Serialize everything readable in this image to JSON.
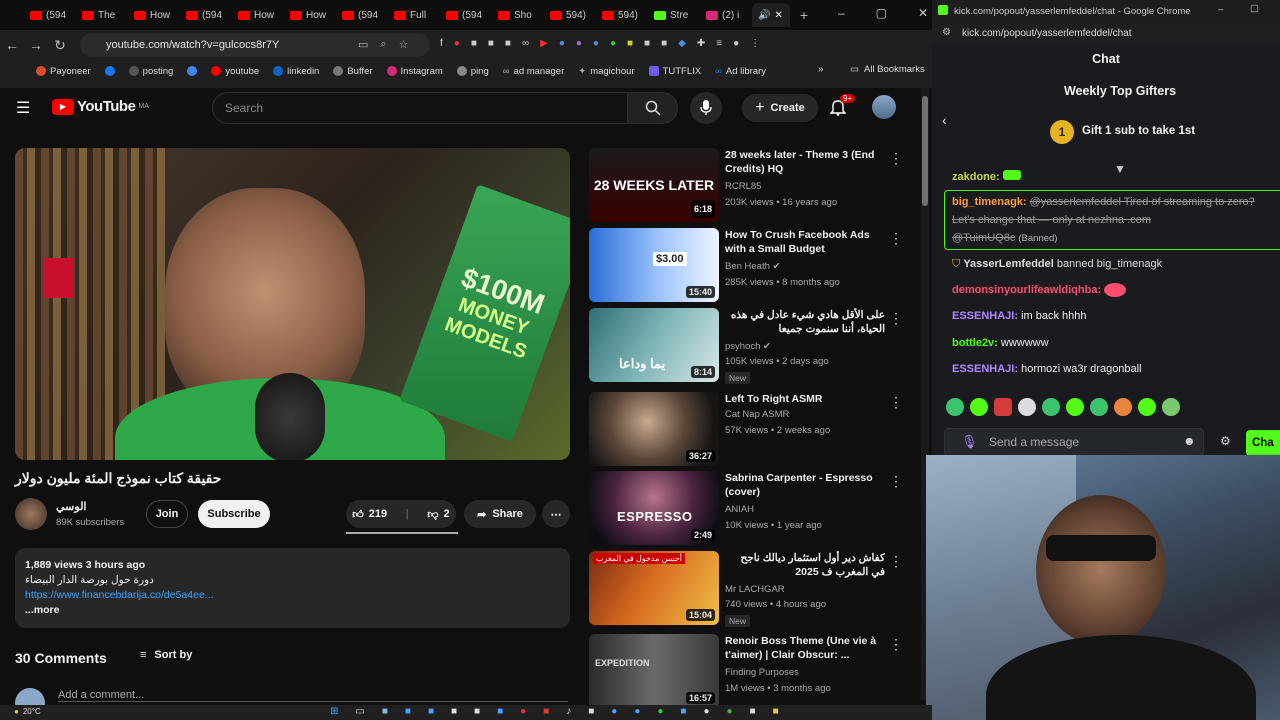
{
  "browser": {
    "tabs": [
      {
        "label": "(594"
      },
      {
        "label": "The"
      },
      {
        "label": "How"
      },
      {
        "label": "(594"
      },
      {
        "label": "How"
      },
      {
        "label": "How"
      },
      {
        "label": "(594"
      },
      {
        "label": "Full"
      },
      {
        "label": "(594"
      },
      {
        "label": "Sho"
      },
      {
        "label": "594)"
      },
      {
        "label": "594)"
      },
      {
        "label": "Stre"
      },
      {
        "label": "(2) i"
      }
    ],
    "url": "youtube.com/watch?v=gulcocs8r7Y",
    "bookmarks": [
      {
        "label": "Payoneer",
        "color": "#e14b2d"
      },
      {
        "label": "",
        "color": "#1877f2"
      },
      {
        "label": "posting",
        "color": "#ddd"
      },
      {
        "label": "",
        "color": "#4285f4"
      },
      {
        "label": "youtube",
        "color": "#ff0000"
      },
      {
        "label": "linkedin",
        "color": "#0a66c2"
      },
      {
        "label": "Buffer",
        "color": "#ddd"
      },
      {
        "label": "Instagram",
        "color": "#d62976"
      },
      {
        "label": "ping",
        "color": "#ddd"
      },
      {
        "label": "ad manager",
        "color": "#ddd"
      },
      {
        "label": "magichour",
        "color": "#ddd"
      },
      {
        "label": "TUTFLIX",
        "color": "#6c5ce7"
      },
      {
        "label": "Ad library",
        "color": "#1877f2"
      }
    ],
    "all_bookmarks": "All Bookmarks"
  },
  "youtube": {
    "logo_text": "YouTube",
    "logo_sup": "MA",
    "search_placeholder": "Search",
    "create_label": "Create",
    "notif_count": "9+",
    "video_title": "حقيقة كتاب نموذج المئة مليون دولار",
    "channel_name": "الوسي",
    "subscribers": "89K subscribers",
    "join_label": "Join",
    "subscribe_label": "Subscribe",
    "likes": "219",
    "dislikes": "2",
    "share_label": "Share",
    "book_text_1": "$100M",
    "book_text_2": "MONEY",
    "book_text_3": "MODELS",
    "description": {
      "stats": "1,889 views  3 hours ago",
      "line1": "دورة حول بورصة الدار البيضاء",
      "link": "https://www.financebdarija.co/de5a4ee...",
      "more": "...more"
    },
    "comments_count": "30 Comments",
    "sort_by": "Sort by",
    "add_comment": "Add a comment...",
    "recommendations": [
      {
        "title": "28 weeks later - Theme 3 (End Credits) HQ",
        "channel": "RCRL85",
        "meta": "203K views • 16 years ago",
        "duration": "6:18",
        "thumb_text": "28 WEEKS LATER",
        "new": "",
        "verified": false
      },
      {
        "title": "How To Crush Facebook Ads with a Small Budget",
        "channel": "Ben Heath",
        "meta": "285K views • 8 months ago",
        "duration": "15:40",
        "thumb_text": "$3.00",
        "new": "",
        "verified": true
      },
      {
        "title": "على الأقل هادي شيء عادل في هذه الحياة، أننا سنموت جميعا",
        "channel": "psyhoch",
        "meta": "105K views • 2 days ago",
        "duration": "8:14",
        "thumb_text": "يما وداعا",
        "new": "New",
        "verified": true
      },
      {
        "title": "Left To Right ASMR",
        "channel": "Cat Nap ASMR",
        "meta": "57K views • 2 weeks ago",
        "duration": "36:27",
        "thumb_text": "",
        "new": "",
        "verified": false
      },
      {
        "title": "Sabrina Carpenter - Espresso (cover)",
        "channel": "ANIAH",
        "meta": "10K views • 1 year ago",
        "duration": "2:49",
        "thumb_text": "ESPRESSO",
        "new": "",
        "verified": false
      },
      {
        "title": "كفاش دير أول استثمار ديالك ناجح في المغرب ف 2025",
        "channel": "Mr LACHGAR",
        "meta": "740 views • 4 hours ago",
        "duration": "15:04",
        "thumb_text": "أحسن مدخول في المغرب",
        "new": "New",
        "verified": false
      },
      {
        "title": "Renoir Boss Theme (Une vie à t'aimer) | Clair Obscur: ...",
        "channel": "Finding Purposes",
        "meta": "1M views • 3 months ago",
        "duration": "16:57",
        "thumb_text": "EXPEDITION",
        "new": "",
        "verified": false
      }
    ]
  },
  "kick": {
    "window_title": "kick.com/popout/yasserlemfeddel/chat - Google Chrome",
    "url": "kick.com/popout/yasserlemfeddel/chat",
    "chat_title": "Chat",
    "top_gifters_title": "Weekly Top Gifters",
    "gift_rank": "1",
    "gift_label": "Gift 1 sub to take 1st",
    "messages": [
      {
        "user": "zakdone:",
        "text": "",
        "color": "#c7d24c",
        "style": "normal"
      },
      {
        "user": "big_timenagk:",
        "text": "@yasserlemfeddel Tired of streaming to zero?",
        "color": "#ff9d3b",
        "style": "strike"
      },
      {
        "user": "",
        "text": "Let's change that — only at nezhna .com",
        "color": "#ccc",
        "style": "strike"
      },
      {
        "user": "",
        "text": "@TuimUQ8c",
        "color": "#ccc",
        "style": "strike",
        "tag": "(Banned)"
      },
      {
        "user": "YasserLemfeddel",
        "text": "banned big_timenagk",
        "color": "#ddd",
        "style": "system"
      },
      {
        "user": "demonsinyourlifeawldiqhba:",
        "text": "",
        "color": "#ff4d6d",
        "style": "normal"
      },
      {
        "user": "ESSENHAJI:",
        "text": "im back hhhh",
        "color": "#b388ff",
        "style": "normal"
      },
      {
        "user": "bottle2v:",
        "text": "wwwwww",
        "color": "#53fc18",
        "style": "normal"
      },
      {
        "user": "ESSENHAJI:",
        "text": "hormozi wa3r dragonball",
        "color": "#b388ff",
        "style": "normal"
      }
    ],
    "send_placeholder": "Send a message",
    "chat_button": "Cha"
  },
  "taskbar": {
    "weather": "20°C"
  }
}
